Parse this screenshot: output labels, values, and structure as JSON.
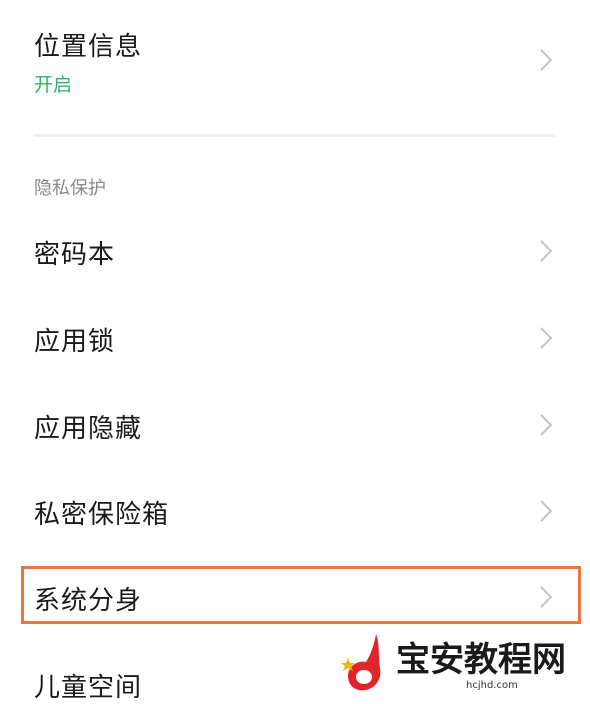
{
  "items": [
    {
      "label": "位置信息",
      "sub": "开启"
    },
    {
      "label": "密码本"
    },
    {
      "label": "应用锁"
    },
    {
      "label": "应用隐藏"
    },
    {
      "label": "私密保险箱"
    },
    {
      "label": "系统分身"
    },
    {
      "label": "儿童空间"
    }
  ],
  "section_title": "隐私保护",
  "watermark": {
    "title": "宝安教程网",
    "url": "hcjhd.com",
    "brand_color": "#e0242a"
  },
  "colors": {
    "accent_green": "#2db36b",
    "highlight": "#e8763f"
  }
}
